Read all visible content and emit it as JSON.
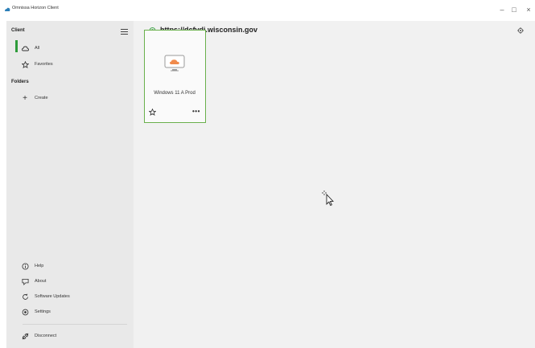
{
  "window": {
    "title": "Omnissa Horizon Client",
    "minimize_glyph": "–",
    "maximize_glyph": "□",
    "close_glyph": "×"
  },
  "sidebar": {
    "client_heading": "Client",
    "client_items": [
      {
        "label": "All",
        "icon": "cloud-icon",
        "active": true
      },
      {
        "label": "Favorites",
        "icon": "star-icon"
      }
    ],
    "folders_heading": "Folders",
    "create_label": "Create",
    "bottom_items": [
      {
        "label": "Help",
        "icon": "info-icon"
      },
      {
        "label": "About",
        "icon": "about-icon"
      },
      {
        "label": "Software Updates",
        "icon": "refresh-icon"
      },
      {
        "label": "Settings",
        "icon": "settings-icon"
      }
    ],
    "disconnect_label": "Disconnect"
  },
  "main": {
    "server_url": "https://dcfvdi.wisconsin.gov",
    "desktops": [
      {
        "name": "Windows 11 A Prod",
        "more_glyph": "•••"
      }
    ]
  },
  "colors": {
    "accent_green": "#2e9b3a",
    "card_border": "#6ab04c",
    "cloud_orange": "#f08a4b"
  }
}
